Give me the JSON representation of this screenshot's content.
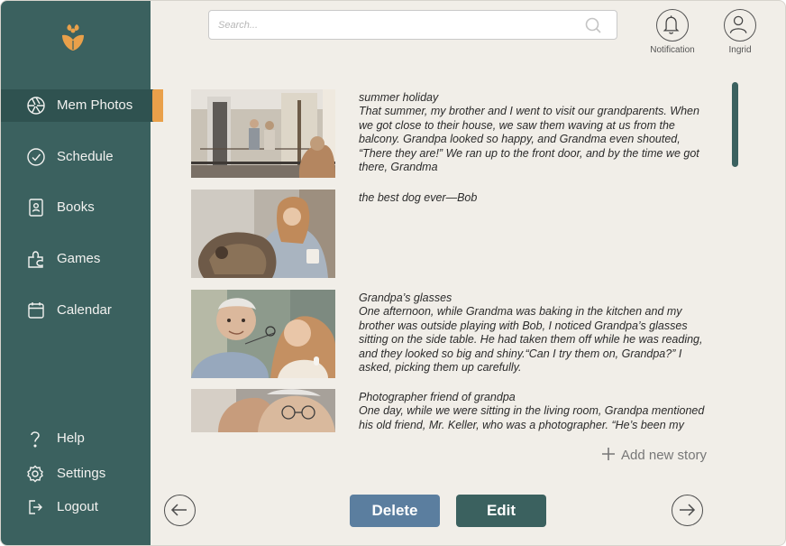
{
  "sidebar": {
    "nav": [
      {
        "label": "Mem Photos",
        "icon": "aperture-icon"
      },
      {
        "label": "Schedule",
        "icon": "check-circle-icon"
      },
      {
        "label": "Books",
        "icon": "book-icon"
      },
      {
        "label": "Games",
        "icon": "puzzle-icon"
      },
      {
        "label": "Calendar",
        "icon": "calendar-icon"
      }
    ],
    "bottom": [
      {
        "label": "Help",
        "icon": "question-icon"
      },
      {
        "label": "Settings",
        "icon": "gear-icon"
      },
      {
        "label": "Logout",
        "icon": "logout-icon"
      }
    ],
    "active": "Mem Photos"
  },
  "search": {
    "placeholder": "Search..."
  },
  "header": {
    "notification_label": "Notification",
    "user_label": "Ingrid"
  },
  "stories": [
    {
      "title": "summer holiday",
      "body": "That summer, my brother and I went to visit our grandparents. When we got close to their house, we saw them waving at us from the balcony. Grandpa looked so happy, and Grandma even shouted, “There they are!” We ran up to the front door, and by the time we got there, Grandma"
    },
    {
      "title": "the best dog ever—Bob",
      "body": ""
    },
    {
      "title": "Grandpa’s glasses",
      "body": "One afternoon, while Grandma was baking in the kitchen and my brother was outside playing with Bob, I noticed Grandpa’s glasses sitting on the side table. He had taken them off while he was reading, and they looked so big and shiny.“Can I try them on, Grandpa?” I asked, picking them up carefully."
    },
    {
      "title": "Photographer friend of grandpa",
      "body": "One day, while we were sitting in the living room, Grandpa mentioned his old friend, Mr. Keller, who was a photographer. “He’s been my"
    }
  ],
  "actions": {
    "add_story": "Add new story",
    "delete": "Delete",
    "edit": "Edit"
  },
  "colors": {
    "sidebar": "#3b615f",
    "accent": "#e9a04a",
    "delete": "#5b7e9f",
    "edit": "#3b615f",
    "background": "#f1eee8"
  }
}
